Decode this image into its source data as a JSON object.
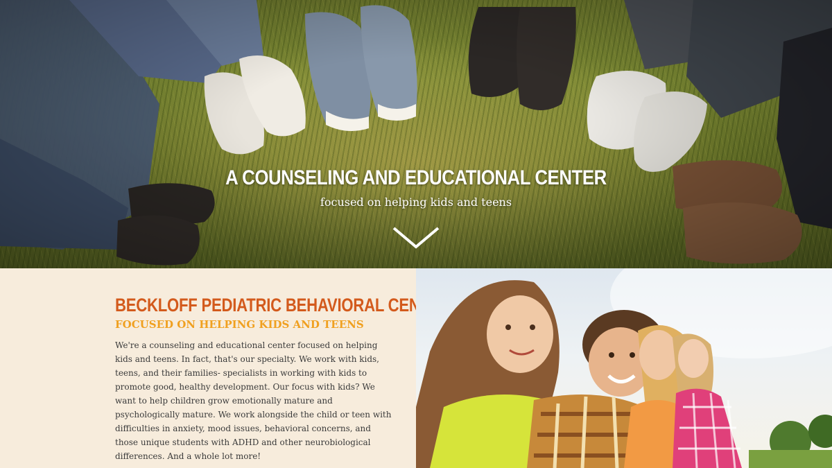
{
  "hero": {
    "title": "A COUNSELING AND EDUCATIONAL CENTER",
    "subtitle": "focused on helping kids and teens",
    "scroll_icon": "chevron-down-icon"
  },
  "intro": {
    "heading": "BECKLOFF PEDIATRIC BEHAVIORAL CENTER",
    "subheading": "FOCUSED ON HELPING KIDS AND TEENS",
    "body": "We're a counseling and educational center focused on helping kids and teens. In fact, that's our specialty. We work with kids, teens, and their families- specialists in working with kids to promote good, healthy development. Our focus with kids? We want to help children grow emotionally mature and psychologically mature. We work alongside the child or teen with difficulties in anxiety, mood issues, behavioral concerns, and those unique students with ADHD and other neurobiological differences. And a whole lot more!"
  },
  "colors": {
    "heading_orange": "#d35a1c",
    "subheading_gold": "#f0a020",
    "section_background": "#f7ecdc"
  }
}
